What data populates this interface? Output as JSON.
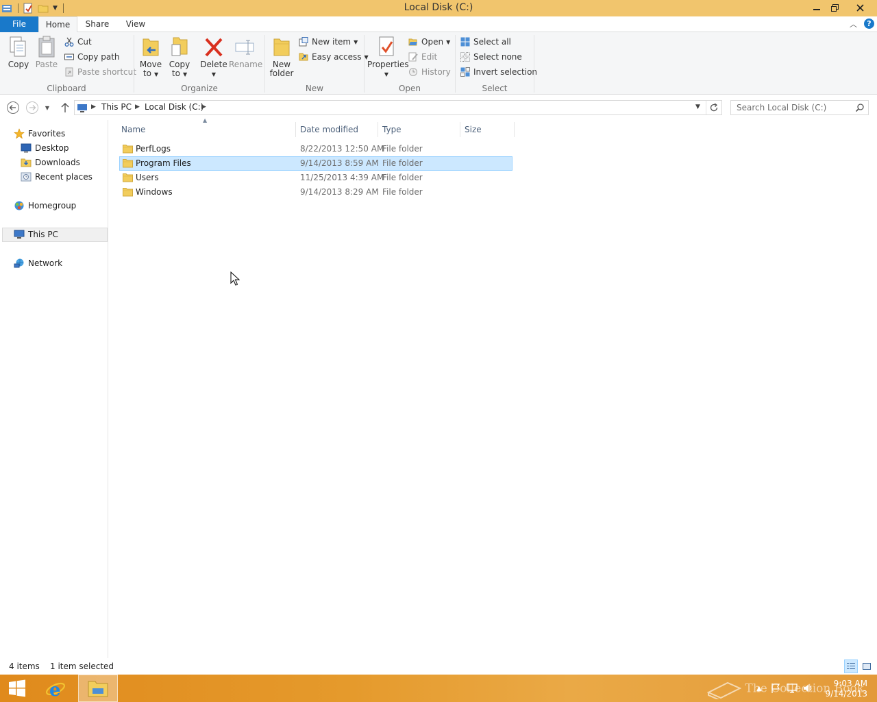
{
  "window": {
    "title": "Local Disk (C:)"
  },
  "tabs": {
    "file": "File",
    "home": "Home",
    "share": "Share",
    "view": "View"
  },
  "ribbon": {
    "clipboard": {
      "label": "Clipboard",
      "copy": "Copy",
      "paste": "Paste",
      "cut": "Cut",
      "copy_path": "Copy path",
      "paste_shortcut": "Paste shortcut"
    },
    "organize": {
      "label": "Organize",
      "move_to_1": "Move",
      "move_to_2": "to",
      "copy_to_1": "Copy",
      "copy_to_2": "to",
      "delete": "Delete",
      "rename": "Rename"
    },
    "new": {
      "label": "New",
      "new_folder_1": "New",
      "new_folder_2": "folder",
      "new_item": "New item",
      "easy_access": "Easy access"
    },
    "open": {
      "label": "Open",
      "properties": "Properties",
      "open": "Open",
      "edit": "Edit",
      "history": "History"
    },
    "select": {
      "label": "Select",
      "select_all": "Select all",
      "select_none": "Select none",
      "invert_selection": "Invert selection"
    }
  },
  "address": {
    "crumbs": [
      "This PC",
      "Local Disk (C:)"
    ],
    "search_placeholder": "Search Local Disk (C:)"
  },
  "nav": {
    "favorites": "Favorites",
    "desktop": "Desktop",
    "downloads": "Downloads",
    "recent_places": "Recent places",
    "homegroup": "Homegroup",
    "this_pc": "This PC",
    "network": "Network"
  },
  "columns": {
    "name": "Name",
    "date": "Date modified",
    "type": "Type",
    "size": "Size"
  },
  "files": [
    {
      "name": "PerfLogs",
      "date": "8/22/2013 12:50 AM",
      "type": "File folder"
    },
    {
      "name": "Program Files",
      "date": "9/14/2013 8:59 AM",
      "type": "File folder",
      "selected": true
    },
    {
      "name": "Users",
      "date": "11/25/2013 4:39 AM",
      "type": "File folder"
    },
    {
      "name": "Windows",
      "date": "9/14/2013 8:29 AM",
      "type": "File folder"
    }
  ],
  "status": {
    "count": "4 items",
    "selected": "1 item selected"
  },
  "taskbar": {
    "time": "9:03 AM",
    "date": "9/14/2013",
    "watermark": "The Collection Book"
  },
  "colors": {
    "titlebar": "#f1c56d",
    "file_tab": "#1979ca",
    "selection": "#cce8ff",
    "taskbar": "#e59a2c"
  }
}
